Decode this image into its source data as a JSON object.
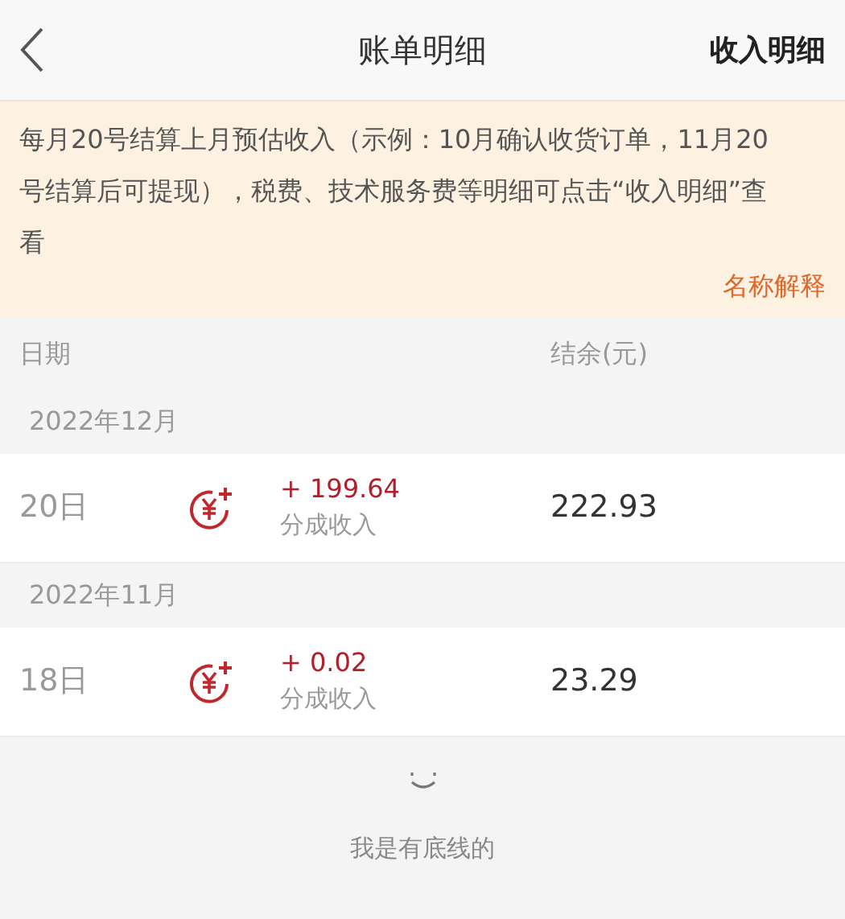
{
  "header": {
    "title": "账单明细",
    "action": "收入明细"
  },
  "notice": {
    "text": "每月20号结算上月预估收入（示例：10月确认收货订单，11月20号结算后可提现），税费、技术服务费等明细可点击“收入明细”查看",
    "link": "名称解释"
  },
  "columns": [
    "日期",
    "结余(元)"
  ],
  "groups": [
    {
      "month": "2022年12月",
      "rows": [
        {
          "day": "20日",
          "amount": "+ 199.64",
          "type": "分成收入",
          "balance": "222.93"
        }
      ]
    },
    {
      "month": "2022年11月",
      "rows": [
        {
          "day": "18日",
          "amount": "+ 0.02",
          "type": "分成收入",
          "balance": "23.29"
        }
      ]
    }
  ],
  "footer": "我是有底线的"
}
